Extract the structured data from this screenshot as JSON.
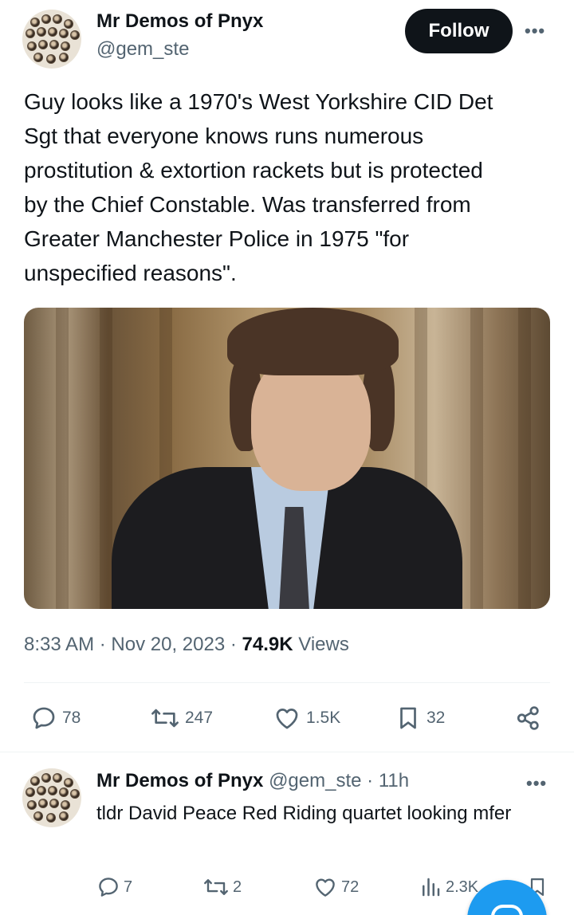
{
  "tweet": {
    "author_name": "Mr Demos of Pnyx",
    "author_handle": "@gem_ste",
    "follow_label": "Follow",
    "more_label": "•••",
    "text": "Guy looks like a 1970's West Yorkshire CID Det\nSgt that everyone knows runs numerous\nprostitution & extortion rackets but is protected\nby the Chief Constable. Was transferred from\nGreater Manchester Police in 1975 \"for\nunspecified reasons\".",
    "time": "8:33 AM",
    "separator": "·",
    "date": "Nov 20, 2023",
    "views_count": "74.9K",
    "views_label": "Views",
    "replies": "78",
    "reposts": "247",
    "likes": "1.5K",
    "bookmarks": "32",
    "icons": {
      "reply": "reply-icon",
      "repost": "repost-icon",
      "like": "heart-icon",
      "bookmark": "bookmark-icon",
      "share": "share-icon",
      "more": "more-icon"
    }
  },
  "reply": {
    "author_name": "Mr Demos of Pnyx",
    "author_handle": "@gem_ste",
    "age": "11h",
    "separator": "·",
    "more_label": "•••",
    "text": "tldr David Peace Red Riding quartet looking mfer",
    "replies": "7",
    "reposts": "2",
    "likes": "72",
    "views": "2.3K",
    "icons": {
      "reply": "reply-icon",
      "repost": "repost-icon",
      "like": "heart-icon",
      "views": "analytics-icon",
      "bookmark": "bookmark-icon"
    }
  },
  "colors": {
    "text_primary": "#0f1419",
    "text_secondary": "#536471",
    "accent": "#1d9bf0",
    "divider": "#eff3f4"
  }
}
